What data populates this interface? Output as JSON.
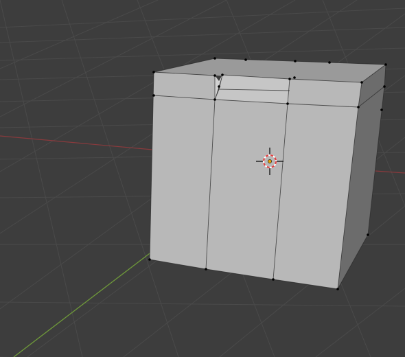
{
  "viewport": {
    "background": "#3d3d3d",
    "grid_color": "#4a4a4a",
    "x_axis_color": "#8a3a3d",
    "y_axis_color": "#6f9a3a"
  },
  "mesh": {
    "front_face_color": "#b8b8b8",
    "top_face_color": "#9a9a9a",
    "right_face_color": "#6c6c6c",
    "notch_color": "#c6c6c6",
    "edge_color": "#2a2a2a",
    "vertex_color": "#000000"
  },
  "cursor": {
    "icon": "3d-cursor-icon",
    "ring_red": "#e04040",
    "ring_white": "#ffffff",
    "center_color": "#e8a000"
  }
}
